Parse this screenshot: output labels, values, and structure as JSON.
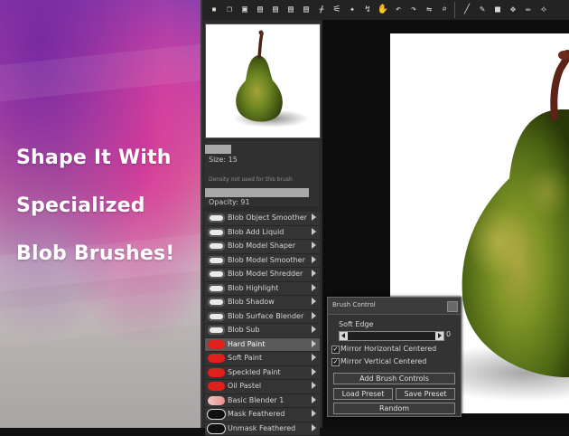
{
  "promo": {
    "line1": "Shape It With",
    "line2": "Specialized",
    "line3": "Blob Brushes!"
  },
  "toolbar": {
    "icons": [
      "save-icon",
      "copy-icon",
      "paste-icon",
      "document-icon",
      "document-icon",
      "document-icon",
      "document-icon",
      "eyedropper-icon",
      "symmetry-icon",
      "magic-wand-icon",
      "lasso-icon",
      "hand-icon",
      "rotate-left-icon",
      "rotate-right-icon",
      "mirror-icon",
      "search-icon",
      "brush-icon",
      "pen-icon",
      "square-icon",
      "move-icon",
      "pencil-icon",
      "pan-icon"
    ]
  },
  "brush_props": {
    "size_label": "Size: 15",
    "density_note": "Density not used for this brush",
    "opacity_label": "Opacity: 91",
    "size_fraction": 0.23,
    "opacity_fraction": 0.91
  },
  "brushes": [
    {
      "label": "Blob Object Smoother",
      "thumb": "blob",
      "selected": false
    },
    {
      "label": "Blob Add Liquid",
      "thumb": "blob",
      "selected": false
    },
    {
      "label": "Blob Model Shaper",
      "thumb": "blob",
      "selected": false
    },
    {
      "label": "Blob Model Smoother",
      "thumb": "blob",
      "selected": false
    },
    {
      "label": "Blob Model Shredder",
      "thumb": "blob",
      "selected": false
    },
    {
      "label": "Blob Highlight",
      "thumb": "blob",
      "selected": false
    },
    {
      "label": "Blob Shadow",
      "thumb": "blob",
      "selected": false
    },
    {
      "label": "Blob Surface Blender",
      "thumb": "blob",
      "selected": false
    },
    {
      "label": "Blob Sub",
      "thumb": "blob",
      "selected": false
    },
    {
      "label": "Hard Paint",
      "thumb": "red",
      "selected": true
    },
    {
      "label": "Soft Paint",
      "thumb": "red",
      "selected": false
    },
    {
      "label": "Speckled Paint",
      "thumb": "red",
      "selected": false
    },
    {
      "label": "Oil Pastel",
      "thumb": "red",
      "selected": false
    },
    {
      "label": "Basic Blender 1",
      "thumb": "pink",
      "selected": false
    },
    {
      "label": "Mask Feathered",
      "thumb": "black",
      "selected": false
    },
    {
      "label": "Unmask Feathered",
      "thumb": "black",
      "selected": false
    }
  ],
  "dialog": {
    "title": "Brush Control",
    "slider_label": "Soft Edge",
    "slider_value": "0",
    "mirror_h": "Mirror Horizontal Centered",
    "mirror_v": "Mirror Vertical Centered",
    "add_button": "Add Brush Controls",
    "load_button": "Load Preset",
    "save_button": "Save Preset",
    "random_button": "Random"
  },
  "colors": {
    "selected_row": "#5a5a5a",
    "pear_green": "#6f8a1e",
    "paint_red": "#e0201a"
  }
}
